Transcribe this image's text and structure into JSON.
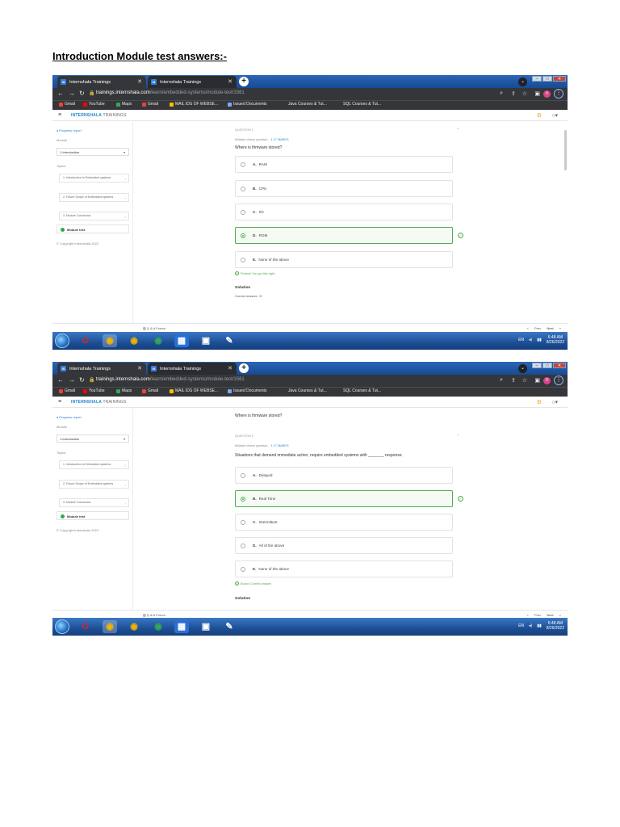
{
  "document": {
    "heading": "Introduction Module test answers:-"
  },
  "browser": {
    "tabs": [
      {
        "title": "Internshala Trainings",
        "favicon": "IS"
      },
      {
        "title": "Internshala Trainings",
        "favicon": "IS"
      }
    ],
    "url_host": "trainings.internshala.com",
    "url_path": "/learn/embedded-systems/module-test/1561",
    "bookmarks": [
      "Gmail",
      "YouTube",
      "Maps",
      "Gmail",
      "MAIL IDS OF WEBSE...",
      "Issued Documents",
      "Java Courses & Tut...",
      "SQL Courses & Tut..."
    ],
    "profile_initial": "V"
  },
  "app": {
    "logo_main": "INTERNSHALA",
    "logo_sub": "TRAININGS",
    "sidebar": {
      "progress_link": "Progress report",
      "module_label": "Module",
      "module_value": "1.Introduction",
      "topics_label": "Topics",
      "topics": [
        "1. Introduction to Embedded systems",
        "2. Future Scope of Embedded systems",
        "3. Module Conclusion"
      ],
      "module_test": "Module test",
      "copyright": "© Copyright Internshala 2022"
    },
    "footer": {
      "forum": "Q & A Forum",
      "prev": "< Prev",
      "next": "Next >"
    }
  },
  "screens": [
    {
      "question_no": "QUESTION 1",
      "question_type": "Multiple choice question",
      "marks": "1.17 MARKS",
      "question": "Where is firmware stored?",
      "options": [
        {
          "letter": "A.",
          "text": "RAM",
          "correct": false
        },
        {
          "letter": "B.",
          "text": "CPU",
          "correct": false
        },
        {
          "letter": "C.",
          "text": "I/O",
          "correct": false
        },
        {
          "letter": "D.",
          "text": "ROM",
          "correct": true
        },
        {
          "letter": "E.",
          "text": "None of the above",
          "correct": false
        }
      ],
      "feedback": "Perfect! You got this right.",
      "solution_heading": "Solution",
      "solution_text": "Correct answer:: D",
      "clock_time": "6:48 AM",
      "clock_date": "8/26/2022",
      "lang": "EN"
    },
    {
      "prev_question": "Where is firmware stored?",
      "question_no": "QUESTION 2",
      "question_type": "Multiple choice question",
      "marks": "1.17 MARKS",
      "question": "Situations that demand immediate action, require embedded systems with _______ response.",
      "options": [
        {
          "letter": "A.",
          "text": "Delayed",
          "correct": false
        },
        {
          "letter": "B.",
          "text": "Real Time",
          "correct": true
        },
        {
          "letter": "C.",
          "text": "Intermittent",
          "correct": false
        },
        {
          "letter": "D.",
          "text": "All of the above",
          "correct": false
        },
        {
          "letter": "E.",
          "text": "None of the above",
          "correct": false
        }
      ],
      "feedback": "Bravo! Correct answer.",
      "solution_heading": "Solution",
      "clock_time": "6:48 AM",
      "clock_date": "8/26/2022",
      "lang": "EN"
    }
  ],
  "colors": {
    "correct_green": "#4cae4c",
    "brand_blue": "#1a86c8",
    "chrome_dark": "#35363a",
    "taskbar_blue": "#1c4f96"
  }
}
